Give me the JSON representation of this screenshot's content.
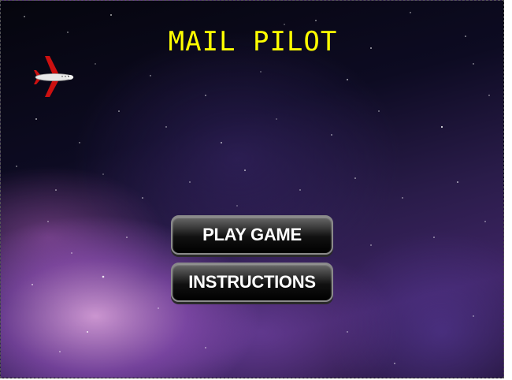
{
  "game": {
    "title": "MAIL PILOT",
    "buttons": {
      "play_label": "PLAY GAME",
      "instructions_label": "INSTRUCTIONS"
    }
  },
  "colors": {
    "title": "#ffff00",
    "button_text": "#ffffff",
    "plane_body": "#e8e8e8",
    "plane_wing": "#cc1010"
  },
  "icons": {
    "player": "airplane-icon"
  }
}
